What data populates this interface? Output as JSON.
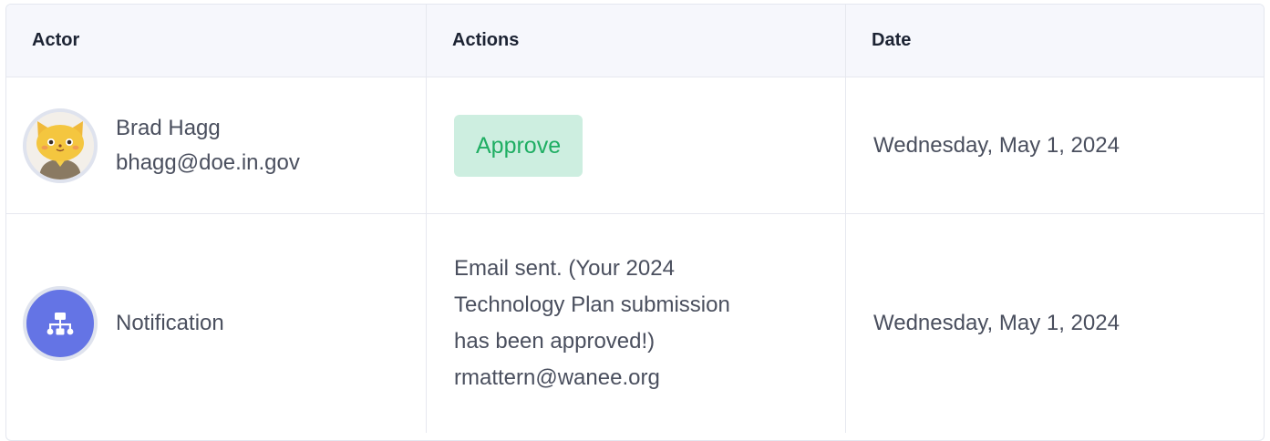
{
  "table": {
    "headers": {
      "actor": "Actor",
      "actions": "Actions",
      "date": "Date"
    },
    "rows": [
      {
        "actor_name": "Brad Hagg",
        "actor_email": "bhagg@doe.in.gov",
        "avatar_icon": "cat-avatar-icon",
        "action_label": "Approve",
        "date": "Wednesday, May 1, 2024"
      },
      {
        "actor_name": "Notification",
        "avatar_icon": "sitemap-icon",
        "action_lines": [
          "Email sent. (Your 2024",
          "Technology Plan submission",
          "has been approved!)",
          "rmattern@wanee.org"
        ],
        "date": "Wednesday, May 1, 2024"
      }
    ]
  },
  "colors": {
    "approve_bg": "#cdeee0",
    "approve_text": "#1fae63",
    "notification_avatar": "#6474e5",
    "header_bg": "#f6f7fc"
  }
}
